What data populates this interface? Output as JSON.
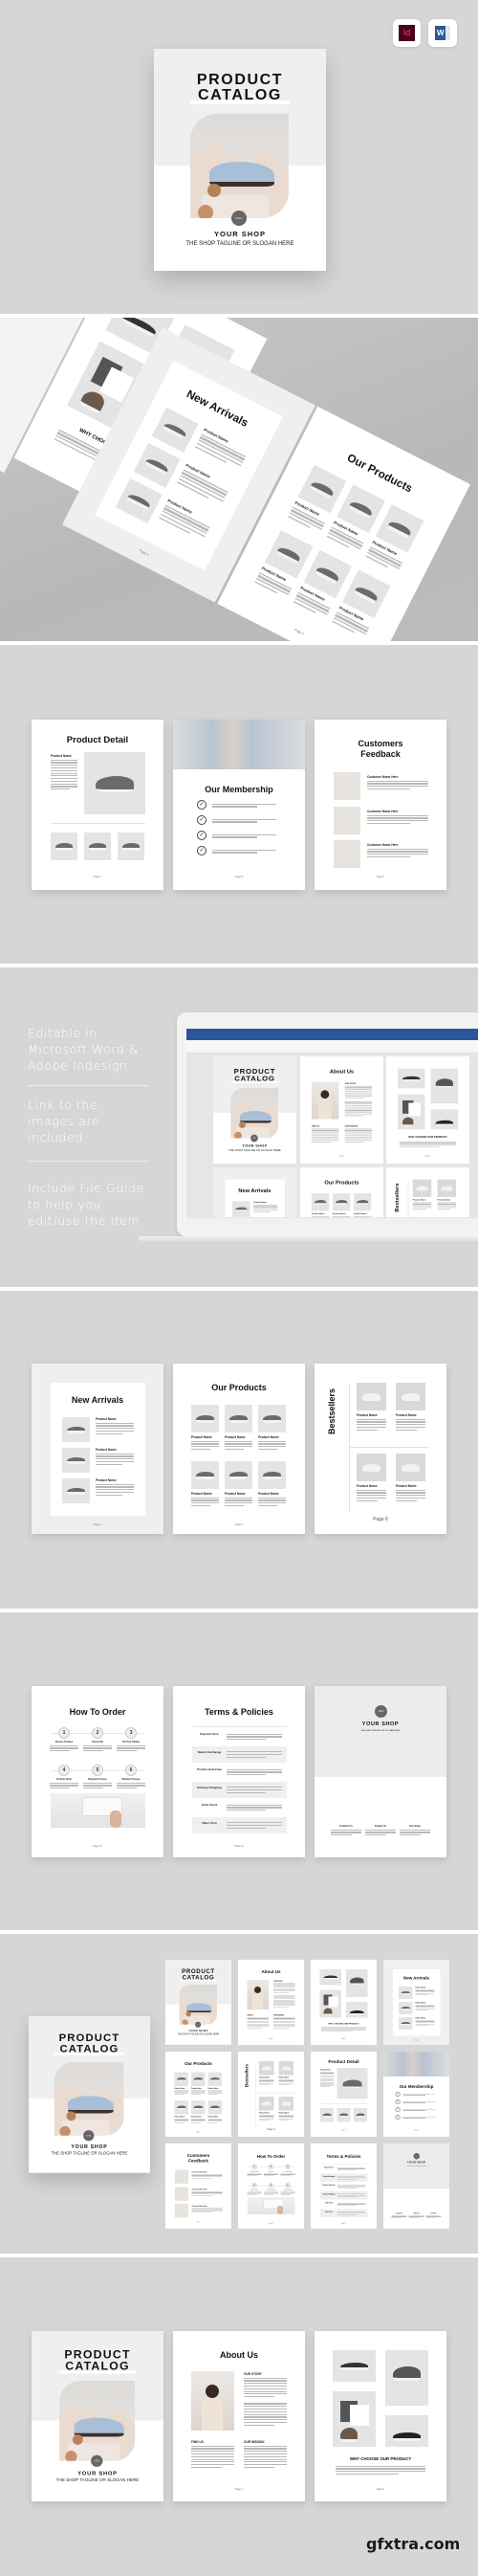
{
  "badges": [
    {
      "label": "Id",
      "bg": "#49021f",
      "fg": "#ff3a7a"
    },
    {
      "label": "W",
      "bg": "#2b579a",
      "fg": "#ffffff"
    }
  ],
  "cover": {
    "title_line1": "PRODUCT",
    "title_line2": "CATALOG",
    "logo": "LFLV",
    "shop": "YOUR SHOP",
    "tagline": "THE SHOP TAGLINE OR SLOGAN HERE"
  },
  "common": {
    "product_name": "Product Name",
    "customer_name": "Customer Name Here"
  },
  "about": {
    "title": "About Us",
    "story": "OUR STORY",
    "find": "FIND US",
    "mission": "OUR MISSION",
    "page": "Page 2"
  },
  "why": {
    "title": "WHY CHOOSE OUR PRODUCT",
    "page": "Page 3"
  },
  "new_arrivals": {
    "title": "New Arrivals",
    "page": "Page 4"
  },
  "products": {
    "title": "Our Products",
    "page": "Page 5"
  },
  "bestsellers": {
    "title": "Bestsellers",
    "page": "Page 6"
  },
  "detail": {
    "title": "Product Detail",
    "page": "Page 7"
  },
  "membership": {
    "title": "Our Membership",
    "page": "Page 8"
  },
  "feedback": {
    "title_line1": "Customers",
    "title_line2": "Feedback",
    "page": "Page 9"
  },
  "order": {
    "title": "How To Order",
    "steps": [
      {
        "n": "1",
        "label": "Choose Product"
      },
      {
        "n": "2",
        "label": "Check Out"
      },
      {
        "n": "3",
        "label": "Fill Your Details"
      },
      {
        "n": "4",
        "label": "Confirm Order"
      },
      {
        "n": "5",
        "label": "Payment Process"
      },
      {
        "n": "6",
        "label": "Delivery Process"
      }
    ],
    "page": "Page 10"
  },
  "terms": {
    "title": "Terms & Policies",
    "rows": [
      "Payment Term",
      "Return/ Exchange",
      "Product Guarantee",
      "Delivery/ Shipping",
      "Order Stock",
      "Other Term"
    ],
    "page": "Page 11"
  },
  "back": {
    "contact": "Contact Us",
    "follow": "Follow Us",
    "store": "Our Store"
  },
  "features": [
    {
      "l1": "Editable in",
      "l2": "Microsoft Word &",
      "l3": "Adobe Indesign"
    },
    {
      "l1": "Link to the",
      "l2": "images are",
      "l3": "included"
    },
    {
      "l1": "Include File Guide",
      "l2": "to help you",
      "l3": "edit/use the item"
    }
  ],
  "colors": {
    "background": "#d6d6d6",
    "word_blue": "#2b579a",
    "page_gray": "#efefef"
  },
  "watermark": "gfxtra.com"
}
